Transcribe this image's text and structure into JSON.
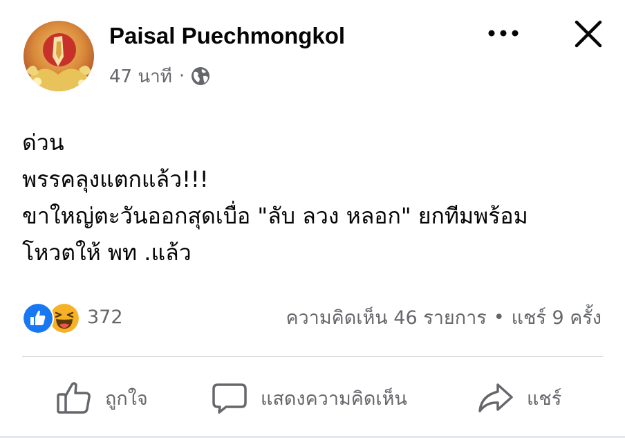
{
  "post": {
    "author": {
      "name": "Paisal Puechmongkol"
    },
    "meta": {
      "time": "47 นาที",
      "separator": "·",
      "privacy_icon": "globe-icon"
    },
    "header_actions": {
      "more_icon": "more-dots-icon",
      "close_icon": "close-icon"
    },
    "text_lines": [
      "ด่วน",
      "พรรคลุงแตกแล้ว!!!",
      "ขาใหญ่ตะวันออกสุดเบื่อ \"ลับ ลวง หลอก\" ยกทีมพร้อม",
      "โหวตให้ พท .แล้ว"
    ],
    "reactions": {
      "icons": [
        "like-reaction-icon",
        "haha-reaction-icon"
      ],
      "count": "372"
    },
    "stats": {
      "comments": "ความคิดเห็น 46 รายการ",
      "separator": "•",
      "shares": "แชร์ 9 ครั้ง"
    },
    "actions": {
      "like_label": "ถูกใจ",
      "comment_label": "แสดงความคิดเห็น",
      "share_label": "แชร์"
    },
    "colors": {
      "primary_text": "#050505",
      "secondary_text": "#65676b",
      "like_blue": "#1877f2",
      "haha_yellow": "#f7b125",
      "divider": "#ced0d4"
    }
  }
}
